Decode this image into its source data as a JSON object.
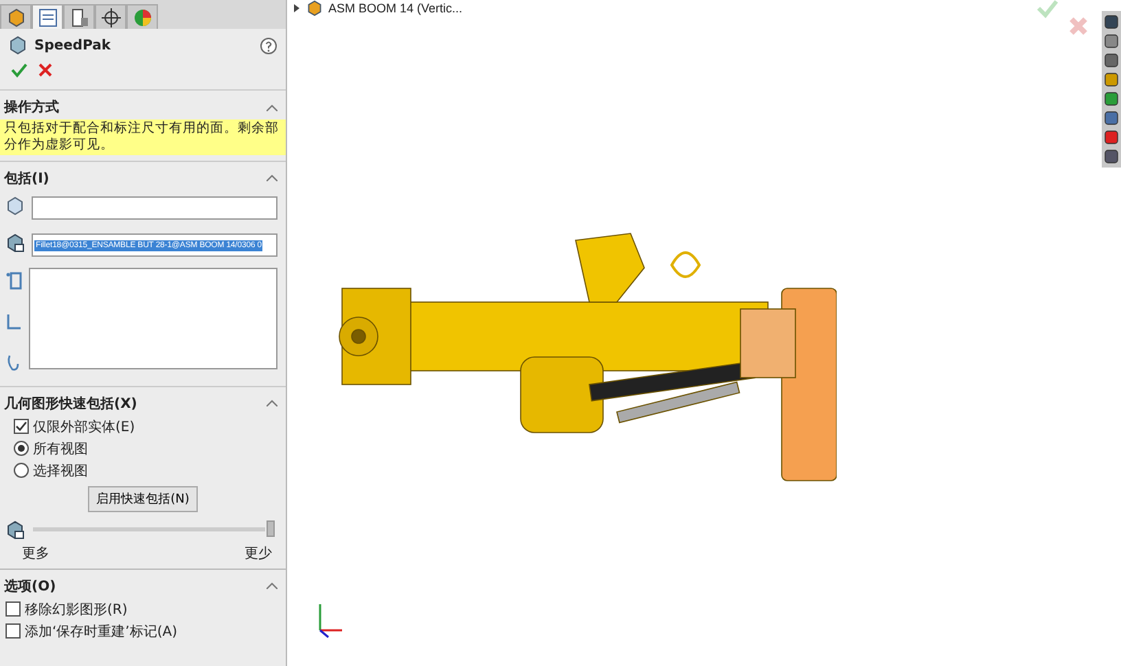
{
  "panel_tabs": [
    {
      "kind": "feature",
      "selected": false
    },
    {
      "kind": "property",
      "selected": true
    },
    {
      "kind": "config",
      "selected": false
    },
    {
      "kind": "dim",
      "selected": false
    },
    {
      "kind": "display",
      "selected": false
    }
  ],
  "title": "SpeedPak",
  "operation": {
    "heading": "操作方式",
    "message": "只包括对于配合和标注尺寸有用的面。剩余部分作为虚影可见。"
  },
  "include": {
    "heading": "包括(I)",
    "bodies_field": {
      "value": "Fillet18@0315_ENSAMBLE BUT 28-1@ASM BOOM 14/0306 0"
    }
  },
  "quick_include": {
    "heading": "几何图形快速包括(X)",
    "options": [
      {
        "kind": "checkbox",
        "label": "仅限外部实体(E)",
        "checked": true
      },
      {
        "kind": "radio",
        "label": "所有视图",
        "selected": true
      },
      {
        "kind": "radio",
        "label": "选择视图",
        "selected": false
      }
    ],
    "button": "启用快速包括(N)",
    "slider": {
      "level": 1,
      "min_label": "更多",
      "max_label": "更少"
    }
  },
  "options": {
    "heading": "选项(O)",
    "items": [
      {
        "label": "移除幻影图形(R)",
        "checked": false
      },
      {
        "label": "添加‘保存时重建’标记(A)",
        "checked": false
      }
    ]
  },
  "tree": {
    "label": "ASM BOOM 14  (Vertic..."
  }
}
